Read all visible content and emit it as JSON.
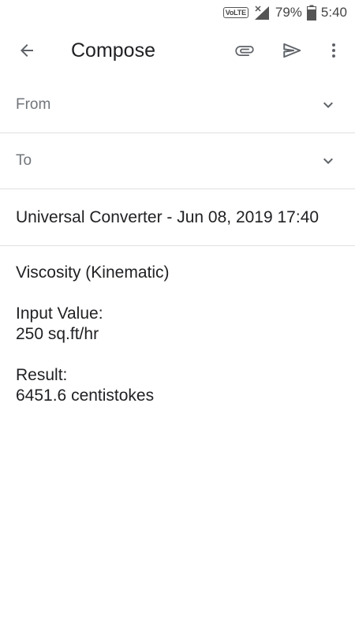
{
  "status_bar": {
    "network_badge": "VoLTE",
    "battery_percent": "79%",
    "time": "5:40"
  },
  "app_bar": {
    "title": "Compose",
    "icons": {
      "back": "arrow-back-icon",
      "attach": "paperclip-icon",
      "send": "send-icon",
      "more": "more-vert-icon"
    }
  },
  "fields": {
    "from_label": "From",
    "to_label": "To"
  },
  "subject": "Universal Converter - Jun 08, 2019 17:40",
  "body": {
    "line1": "Viscosity (Kinematic)",
    "input_label": "Input Value:",
    "input_value": "250 sq.ft/hr",
    "result_label": "Result:",
    "result_value": "6451.6 centistokes"
  },
  "colors": {
    "text_primary": "#202124",
    "text_secondary": "#70757a",
    "divider": "#e0e0e0",
    "icon": "#5f6368"
  }
}
